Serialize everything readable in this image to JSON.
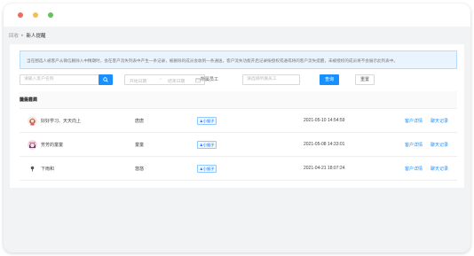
{
  "window": {
    "controls": [
      "close",
      "minimize",
      "zoom"
    ]
  },
  "breadcrumb": {
    "parent": "回收",
    "current": "新人提醒"
  },
  "notice": {
    "text": "当在圈选人被客户从微信删除入中精期时，会在客户流失列表中产生一条记录，被删除的成员会收到一条通送，客户流失功能开启记录按授权或通或将的客户流失提醒，未被授权的成员将不会展示此列表中。"
  },
  "filters": {
    "search_placeholder": "请输入客户名称",
    "search_icon": "search-icon",
    "date_start_placeholder": "开始日期",
    "date_arrow": "→",
    "date_end_placeholder": "结束日期",
    "calendar_icon": "calendar-icon",
    "owner_label": "所属员工",
    "owner_placeholder": "请选择所属员工",
    "query_label": "查询",
    "reset_label": "重置"
  },
  "table": {
    "headers": [
      "流失客户",
      "备注名称",
      "所属员工",
      "流失时间",
      "操作"
    ],
    "rows": [
      {
        "avatar": "girl-avatar",
        "customer": "好好学习、天天向上",
        "remark": "唐唐",
        "staff": "♟小猴子",
        "time": "2021-05-10 14:54:59",
        "action1": "客户详情",
        "action2": "聊天记录"
      },
      {
        "avatar": "anime-avatar",
        "customer": "芳芳的童童",
        "remark": "童童",
        "staff": "♟小猴子",
        "time": "2021-05-08 14:33:01",
        "action1": "客户详情",
        "action2": "聊天记录"
      },
      {
        "avatar": "tree-avatar",
        "customer": "下雨和",
        "remark": "悠悠",
        "staff": "♟小猴子",
        "time": "2021-04-21 18:07:24",
        "action1": "客户详情",
        "action2": "聊天记录"
      }
    ]
  },
  "colors": {
    "primary": "#1890ff",
    "notice_bg": "#eaf4fe",
    "page_bg": "#f2f3f5"
  }
}
